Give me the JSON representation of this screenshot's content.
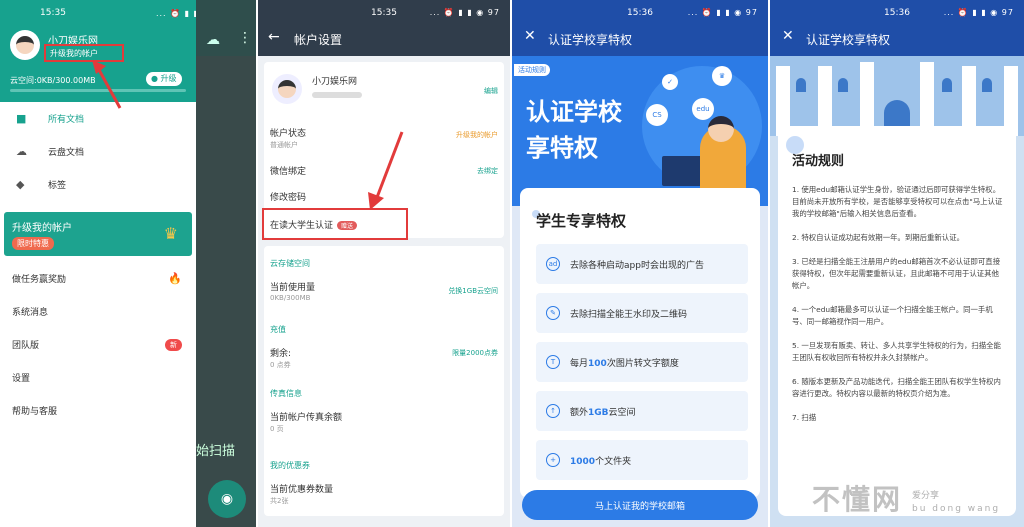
{
  "status_bar": {
    "time1": "15:35",
    "time2": "15:35",
    "time3": "15:36",
    "time4": "15:36",
    "icons": "... ⏰ ▮ ▮ ◉ 97"
  },
  "p1": {
    "username": "小刀娱乐网",
    "upgrade_link": "升级我的帐户",
    "cloud_space": "云空间:0KB/300.00MB",
    "upgrade_btn": "升级",
    "menu": [
      {
        "label": "所有文档",
        "icon": "folder-icon"
      },
      {
        "label": "云盘文档",
        "icon": "cloud-icon"
      },
      {
        "label": "标签",
        "icon": "tag-icon"
      }
    ],
    "vip": {
      "title": "升级我的帐户",
      "badge": "限时特惠"
    },
    "menu2": [
      {
        "label": "做任务赢奖励",
        "extra": "🔥"
      },
      {
        "label": "系统消息",
        "extra": ""
      },
      {
        "label": "团队版",
        "extra": "新"
      },
      {
        "label": "设置",
        "extra": ""
      },
      {
        "label": "帮助与客服",
        "extra": ""
      }
    ],
    "scan_text": "始扫描"
  },
  "p2": {
    "title": "帐户设置",
    "name": "小刀娱乐网",
    "edit": "编辑",
    "status_label": "帐户状态",
    "status_sub": "普通帐户",
    "status_val": "升级我的帐户",
    "wechat": "微信绑定",
    "wechat_val": "去绑定",
    "password": "修改密码",
    "student": "在读大学生认证",
    "student_tag": "赠送",
    "sec_cloud": "云存储空间",
    "used": "当前使用量",
    "used_sub": "0KB/300MB",
    "used_val": "兑换1GB云空间",
    "sec_charge": "充值",
    "remain": "剩余:",
    "remain_sub": "0 点券",
    "remain_val": "限量2000点券",
    "sec_fax": "传真信息",
    "fax": "当前帐户传真余额",
    "fax_sub": "0 页",
    "sec_coupon": "我的优惠券",
    "coupon": "当前优惠券数量",
    "coupon_sub": "共2张"
  },
  "p3": {
    "title": "认证学校享特权",
    "rule_tag": "活动规则",
    "hero_text": "认证学校享特权",
    "bubbles": [
      "CS",
      "edu"
    ],
    "card_title": "学生专享特权",
    "features": [
      {
        "pre": "去除各种启动app时会出现的广告",
        "bold": "",
        "post": "",
        "icon": "ad-icon"
      },
      {
        "pre": "去除扫描全能王水印及二维码",
        "bold": "",
        "post": "",
        "icon": "eraser-icon"
      },
      {
        "pre": "每月",
        "bold": "100",
        "post": "次图片转文字额度",
        "icon": "ocr-icon"
      },
      {
        "pre": "额外",
        "bold": "1GB",
        "post": "云空间",
        "icon": "cloud-upload-icon"
      },
      {
        "pre": "",
        "bold": "1000",
        "post": "个文件夹",
        "icon": "folder-add-icon"
      }
    ],
    "button": "马上认证我的学校邮箱"
  },
  "p4": {
    "title": "认证学校享特权",
    "card_title": "活动规则",
    "rules": [
      "1. 使用edu邮箱认证学生身份，验证通过后即可获得学生特权。目前尚未开放所有学校，是否能够享受特权可以在点击\"马上认证我的学校邮箱\"后输入相关信息后查看。",
      "2. 特权自认证成功起有效期一年。到期后重新认证。",
      "3. 已经是扫描全能王注册用户的edu邮箱首次不必认证即可直接获得特权，但次年起需要重新认证，且此邮箱不可用于认证其他帐户。",
      "4. 一个edu邮箱最多可以认证一个扫描全能王帐户。同一手机号、同一邮箱视作同一用户。",
      "5. 一旦发现有贩卖、转让、多人共享学生特权的行为，扫描全能王团队有权收回所有特权并永久封禁帐户。",
      "6. 随版本更新及产品功能迭代，扫描全能王团队有权学生特权内容进行更改。特权内容以最新的特权页介绍为准。",
      "7. 扫描"
    ]
  },
  "watermark": {
    "main": "不懂网",
    "py1": "爱分享",
    "py2": "bu dong wang"
  },
  "colors": {
    "teal": "#17a28e",
    "red": "#e23b3b",
    "blue": "#2c7be6",
    "navy": "#303d4b"
  }
}
